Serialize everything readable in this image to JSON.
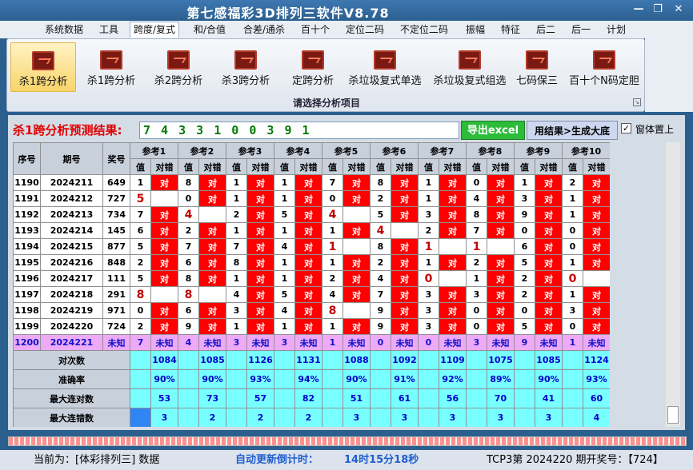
{
  "window": {
    "title": "第七感福彩3D排列三软件V8.78",
    "minimize": "—",
    "maximize": "❐",
    "close": "✕"
  },
  "menu": [
    "系统数据",
    "工具",
    "跨度/复式",
    "和/合值",
    "合差/通杀",
    "百十个",
    "定位二码",
    "不定位二码",
    "振幅",
    "特征",
    "后二",
    "后一",
    "计划"
  ],
  "ribbon": {
    "buttons": [
      "杀1跨分析",
      "杀1跨分析",
      "杀2跨分析",
      "杀3跨分析",
      "定跨分析",
      "杀垃圾复式单选",
      "杀垃圾复式组选",
      "七码保三",
      "百十个N码定胆"
    ],
    "group_label": "请选择分析项目",
    "launcher": "↘"
  },
  "prediction": {
    "label": "杀1跨分析预测结果:",
    "value": "7 4 3 3 1 0 0 3 9 1"
  },
  "actions": {
    "export": "导出excel",
    "generate": "用结果>生成大底",
    "check_mark": "✓",
    "always_on_top": "窗体置上"
  },
  "table": {
    "head_seq": "序号",
    "head_issue": "期号",
    "head_prize": "奖号",
    "ref_groups": [
      "参考1",
      "参考2",
      "参考3",
      "参考4",
      "参考5",
      "参考6",
      "参考7",
      "参考8",
      "参考9",
      "参考10"
    ],
    "sub_value": "值",
    "sub_judge": "对错",
    "rows": [
      {
        "seq": "1190",
        "issue": "2024211",
        "prize": "649",
        "cells": [
          [
            "1",
            "对"
          ],
          [
            "8",
            "对"
          ],
          [
            "1",
            "对"
          ],
          [
            "1",
            "对"
          ],
          [
            "7",
            "对"
          ],
          [
            "8",
            "对"
          ],
          [
            "1",
            "对"
          ],
          [
            "0",
            "对"
          ],
          [
            "1",
            "对"
          ],
          [
            "2",
            "对"
          ]
        ]
      },
      {
        "seq": "1191",
        "issue": "2024212",
        "prize": "727",
        "cells": [
          [
            "5",
            ""
          ],
          [
            "0",
            "对"
          ],
          [
            "1",
            "对"
          ],
          [
            "1",
            "对"
          ],
          [
            "0",
            "对"
          ],
          [
            "2",
            "对"
          ],
          [
            "1",
            "对"
          ],
          [
            "4",
            "对"
          ],
          [
            "3",
            "对"
          ],
          [
            "1",
            "对"
          ]
        ]
      },
      {
        "seq": "1192",
        "issue": "2024213",
        "prize": "734",
        "cells": [
          [
            "7",
            "对"
          ],
          [
            "4",
            ""
          ],
          [
            "2",
            "对"
          ],
          [
            "5",
            "对"
          ],
          [
            "4",
            ""
          ],
          [
            "5",
            "对"
          ],
          [
            "3",
            "对"
          ],
          [
            "8",
            "对"
          ],
          [
            "9",
            "对"
          ],
          [
            "1",
            "对"
          ]
        ]
      },
      {
        "seq": "1193",
        "issue": "2024214",
        "prize": "145",
        "cells": [
          [
            "6",
            "对"
          ],
          [
            "2",
            "对"
          ],
          [
            "1",
            "对"
          ],
          [
            "1",
            "对"
          ],
          [
            "1",
            "对"
          ],
          [
            "4",
            ""
          ],
          [
            "2",
            "对"
          ],
          [
            "7",
            "对"
          ],
          [
            "0",
            "对"
          ],
          [
            "0",
            "对"
          ]
        ]
      },
      {
        "seq": "1194",
        "issue": "2024215",
        "prize": "877",
        "cells": [
          [
            "5",
            "对"
          ],
          [
            "7",
            "对"
          ],
          [
            "7",
            "对"
          ],
          [
            "4",
            "对"
          ],
          [
            "1",
            ""
          ],
          [
            "8",
            "对"
          ],
          [
            "1",
            ""
          ],
          [
            "1",
            ""
          ],
          [
            "6",
            "对"
          ],
          [
            "0",
            "对"
          ]
        ]
      },
      {
        "seq": "1195",
        "issue": "2024216",
        "prize": "848",
        "cells": [
          [
            "2",
            "对"
          ],
          [
            "6",
            "对"
          ],
          [
            "8",
            "对"
          ],
          [
            "1",
            "对"
          ],
          [
            "1",
            "对"
          ],
          [
            "2",
            "对"
          ],
          [
            "1",
            "对"
          ],
          [
            "2",
            "对"
          ],
          [
            "5",
            "对"
          ],
          [
            "1",
            "对"
          ]
        ]
      },
      {
        "seq": "1196",
        "issue": "2024217",
        "prize": "111",
        "cells": [
          [
            "5",
            "对"
          ],
          [
            "8",
            "对"
          ],
          [
            "1",
            "对"
          ],
          [
            "1",
            "对"
          ],
          [
            "2",
            "对"
          ],
          [
            "4",
            "对"
          ],
          [
            "0",
            ""
          ],
          [
            "1",
            "对"
          ],
          [
            "2",
            "对"
          ],
          [
            "0",
            ""
          ]
        ]
      },
      {
        "seq": "1197",
        "issue": "2024218",
        "prize": "291",
        "cells": [
          [
            "8",
            ""
          ],
          [
            "8",
            ""
          ],
          [
            "4",
            "对"
          ],
          [
            "5",
            "对"
          ],
          [
            "4",
            "对"
          ],
          [
            "7",
            "对"
          ],
          [
            "3",
            "对"
          ],
          [
            "3",
            "对"
          ],
          [
            "2",
            "对"
          ],
          [
            "1",
            "对"
          ]
        ]
      },
      {
        "seq": "1198",
        "issue": "2024219",
        "prize": "971",
        "cells": [
          [
            "0",
            "对"
          ],
          [
            "6",
            "对"
          ],
          [
            "3",
            "对"
          ],
          [
            "4",
            "对"
          ],
          [
            "8",
            ""
          ],
          [
            "9",
            "对"
          ],
          [
            "3",
            "对"
          ],
          [
            "0",
            "对"
          ],
          [
            "0",
            "对"
          ],
          [
            "3",
            "对"
          ]
        ]
      },
      {
        "seq": "1199",
        "issue": "2024220",
        "prize": "724",
        "cells": [
          [
            "2",
            "对"
          ],
          [
            "9",
            "对"
          ],
          [
            "1",
            "对"
          ],
          [
            "1",
            "对"
          ],
          [
            "1",
            "对"
          ],
          [
            "9",
            "对"
          ],
          [
            "3",
            "对"
          ],
          [
            "0",
            "对"
          ],
          [
            "5",
            "对"
          ],
          [
            "0",
            "对"
          ]
        ]
      }
    ],
    "unknown_row": {
      "seq": "1200",
      "issue": "2024221",
      "prize": "未知",
      "values": [
        "7",
        "4",
        "3",
        "3",
        "1",
        "0",
        "0",
        "3",
        "9",
        "1"
      ],
      "judge": "未知"
    },
    "stats": [
      {
        "label": "对次数",
        "values": [
          "1084",
          "1085",
          "1126",
          "1131",
          "1088",
          "1092",
          "1109",
          "1075",
          "1085",
          "1124"
        ]
      },
      {
        "label": "准确率",
        "values": [
          "90%",
          "90%",
          "93%",
          "94%",
          "90%",
          "91%",
          "92%",
          "89%",
          "90%",
          "93%"
        ]
      },
      {
        "label": "最大连对数",
        "values": [
          "53",
          "73",
          "57",
          "82",
          "51",
          "61",
          "56",
          "70",
          "41",
          "60"
        ]
      },
      {
        "label": "最大连错数",
        "values": [
          "3",
          "2",
          "2",
          "2",
          "3",
          "3",
          "3",
          "3",
          "3",
          "4"
        ]
      }
    ]
  },
  "status": {
    "current": "当前为：[体彩排列三] 数据",
    "countdown_label": "自动更新倒计时：",
    "countdown": "14时15分18秒",
    "last": "TCP3第 2024220 期开奖号：【724】"
  },
  "colors": {
    "hit": "#ff0000",
    "unknown_row": "#eeaaf6",
    "stats": "#78ffff",
    "prediction": "#007a00",
    "alert": "#e00000"
  }
}
